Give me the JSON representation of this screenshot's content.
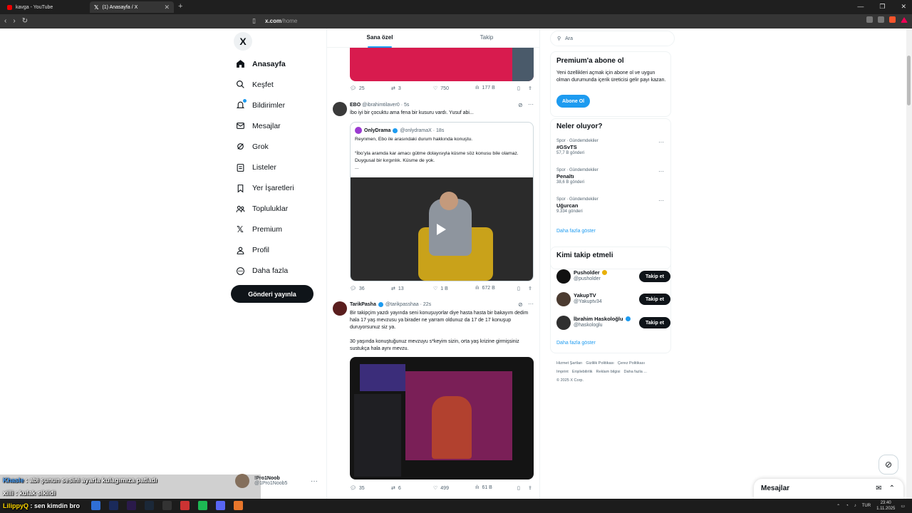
{
  "browser": {
    "tabs": [
      {
        "title": "kavga - YouTube"
      },
      {
        "title": "(1) Anasayfa / X"
      }
    ],
    "url_host": "x.com",
    "url_path": "/home"
  },
  "sidebar": {
    "logo": "X",
    "items": [
      {
        "label": "Anasayfa",
        "icon": "home-icon"
      },
      {
        "label": "Keşfet",
        "icon": "search-icon"
      },
      {
        "label": "Bildirimler",
        "icon": "bell-icon"
      },
      {
        "label": "Mesajlar",
        "icon": "mail-icon"
      },
      {
        "label": "Grok",
        "icon": "grok-icon"
      },
      {
        "label": "Listeler",
        "icon": "list-icon"
      },
      {
        "label": "Yer İşaretleri",
        "icon": "bookmark-icon"
      },
      {
        "label": "Topluluklar",
        "icon": "people-icon"
      },
      {
        "label": "Premium",
        "icon": "x-icon"
      },
      {
        "label": "Profil",
        "icon": "person-icon"
      },
      {
        "label": "Daha fazla",
        "icon": "more-circle-icon"
      }
    ],
    "post_button": "Gönderi yayınla",
    "account": {
      "name": "!Pro1Noob",
      "handle": "@1Pro1Noob5"
    }
  },
  "feed": {
    "tabs": [
      "Sana özel",
      "Takip"
    ],
    "post0_actions": {
      "replies": "25",
      "reposts": "3",
      "likes": "750",
      "views": "177 B"
    },
    "post1": {
      "name": "EBO",
      "meta": "@ibrahimtilaver0 · 5s",
      "text": "İbo iyi bir çocuktu ama fena bir kusuru vardı. Yusuf abi...",
      "quote": {
        "name": "OnlyDrama",
        "meta": "@onlydramaX · 18s",
        "line1": "Reynmen, Ebo ile arasındaki durum hakkında konuştu.",
        "line2": "“İbo’yla aramda kar amacı gütme dolayısıyla küsme söz konusu bile olamaz. Duygusal bir kırgınlık. Küsme de yok.",
        "line3": "..."
      },
      "actions": {
        "replies": "36",
        "reposts": "13",
        "likes": "1 B",
        "views": "672 B"
      }
    },
    "post2": {
      "name": "TarikPasha",
      "meta": "@tarikpasshaa · 22s",
      "text1": "Bir takipçim yazdı yayında seni konuşuyorlar diye hasta hasta bir bakayım dedim hala 17 yaş mevzusu ya birader ne yarram oldunuz da 17 de 17 konuşup duruyorsunuz siz ya.",
      "text2": "30 yaşında konuştuğunuz mevzuyu s*keyim sizin, orta yaş krizine girmişsiniz sustukça hala aynı mevzu.",
      "actions": {
        "replies": "35",
        "reposts": "6",
        "likes": "499",
        "views": "61 B"
      }
    }
  },
  "right": {
    "search_placeholder": "Ara",
    "premium": {
      "title": "Premium'a abone ol",
      "text": "Yeni özellikleri açmak için abone ol ve uygun olman durumunda içerik üreticisi gelir payı kazan.",
      "button": "Abone Ol"
    },
    "trends_title": "Neler oluyor?",
    "trends": [
      {
        "category": "Spor · Gündemdekiler",
        "topic": "#GSvTS",
        "count": "57,7 B gönderi"
      },
      {
        "category": "Spor · Gündemdekiler",
        "topic": "Penaltı",
        "count": "38,6 B gönderi"
      },
      {
        "category": "Spor · Gündemdekiler",
        "topic": "Uğurcan",
        "count": "9.334 gönderi"
      }
    ],
    "show_more": "Daha fazla göster",
    "who_title": "Kimi takip etmeli",
    "who": [
      {
        "name": "Pusholder",
        "handle": "@pusholder",
        "badge": "gold"
      },
      {
        "name": "YakupTV",
        "handle": "@Yakuptv34",
        "badge": ""
      },
      {
        "name": "İbrahim Haskoloğlu",
        "handle": "@haskologlu",
        "badge": "blue"
      }
    ],
    "follow_label": "Takip et",
    "footer": [
      "Hizmet Şartları",
      "Gizlilik Politikası",
      "Çerez Politikası",
      "Imprint",
      "Erişilebilirlik",
      "Reklam bilgisi",
      "Daha fazla ...",
      "© 2025 X Corp."
    ]
  },
  "dock": {
    "messages": "Mesajlar"
  },
  "stream_chat": [
    {
      "user": "Khasle",
      "text": "abi şunun sesini ayarla kulagımıza patladı"
    },
    {
      "user": "xilli",
      "text": "kulak sikildi"
    },
    {
      "user": "LilippyQ",
      "text": "sen kimdin bro"
    }
  ],
  "taskbar": {
    "lang": "TUR",
    "time": "23:40",
    "date": "1.11.2025"
  },
  "colors": {
    "accent": "#1d9bf0",
    "text": "#0f1419",
    "muted": "#536471"
  }
}
